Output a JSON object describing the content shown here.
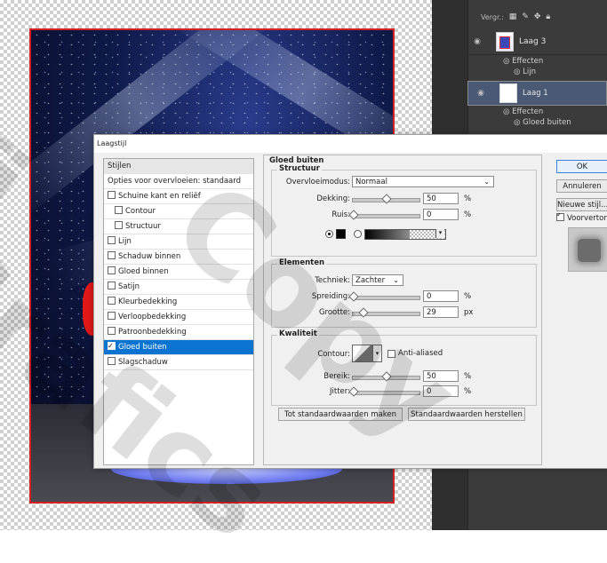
{
  "layers_panel": {
    "vergr_label": "Vergr.:",
    "lock_icons": [
      "checkerboard-lock-icon",
      "brush-lock-icon",
      "move-lock-icon",
      "padlock-icon"
    ],
    "layers": [
      {
        "name": "Laag 3",
        "effects_label": "Effecten",
        "effects": [
          "Lijn"
        ],
        "selected": false
      },
      {
        "name": "Laag 1",
        "effects_label": "Effecten",
        "effects": [
          "Gloed buiten"
        ],
        "selected": true
      }
    ]
  },
  "dialog": {
    "title": "Laagstijl",
    "styles_header": "Stijlen",
    "blend_options": "Opties voor overvloeien: standaard",
    "items": [
      {
        "label": "Schuine kant en reliëf",
        "checked": false,
        "sub": false
      },
      {
        "label": "Contour",
        "checked": false,
        "sub": true
      },
      {
        "label": "Structuur",
        "checked": false,
        "sub": true
      },
      {
        "label": "Lijn",
        "checked": false,
        "sub": false
      },
      {
        "label": "Schaduw binnen",
        "checked": false,
        "sub": false
      },
      {
        "label": "Gloed binnen",
        "checked": false,
        "sub": false
      },
      {
        "label": "Satijn",
        "checked": false,
        "sub": false
      },
      {
        "label": "Kleurbedekking",
        "checked": false,
        "sub": false
      },
      {
        "label": "Verloopbedekking",
        "checked": false,
        "sub": false
      },
      {
        "label": "Patroonbedekking",
        "checked": false,
        "sub": false
      },
      {
        "label": "Gloed buiten",
        "checked": true,
        "sub": false,
        "selected": true
      },
      {
        "label": "Slagschaduw",
        "checked": false,
        "sub": false
      }
    ],
    "panel_title": "Gloed buiten",
    "structuur": {
      "title": "Structuur",
      "blend_mode_label": "Overvloeimodus:",
      "blend_mode_value": "Normaal",
      "opacity_label": "Dekking:",
      "opacity_value": "50",
      "opacity_unit": "%",
      "noise_label": "Ruis:",
      "noise_value": "0",
      "noise_unit": "%",
      "color_mode": "solid",
      "glow_color": "#000000"
    },
    "elementen": {
      "title": "Elementen",
      "technique_label": "Techniek:",
      "technique_value": "Zachter",
      "spread_label": "Spreiding:",
      "spread_value": "0",
      "spread_unit": "%",
      "size_label": "Grootte:",
      "size_value": "29",
      "size_unit": "px"
    },
    "kwaliteit": {
      "title": "Kwaliteit",
      "contour_label": "Contour:",
      "antialias_label": "Anti-aliased",
      "antialias_checked": false,
      "range_label": "Bereik:",
      "range_value": "50",
      "range_unit": "%",
      "jitter_label": "Jitter:",
      "jitter_value": "0",
      "jitter_unit": "%"
    },
    "make_default_button": "Tot standaardwaarden maken",
    "reset_default_button": "Standaardwaarden herstellen",
    "ok_button": "OK",
    "cancel_button": "Annuleren",
    "new_style_button": "Nieuwe stijl...",
    "preview_label": "Voorvertoning",
    "preview_checked": true
  },
  "watermark": {
    "text1": "Copy",
    "text2": "Grafics",
    "text3": "fi"
  },
  "colors": {
    "selection_blue": "#0a74d0",
    "artwork_border": "#d42020",
    "panel_dark": "#3b3b3b"
  }
}
